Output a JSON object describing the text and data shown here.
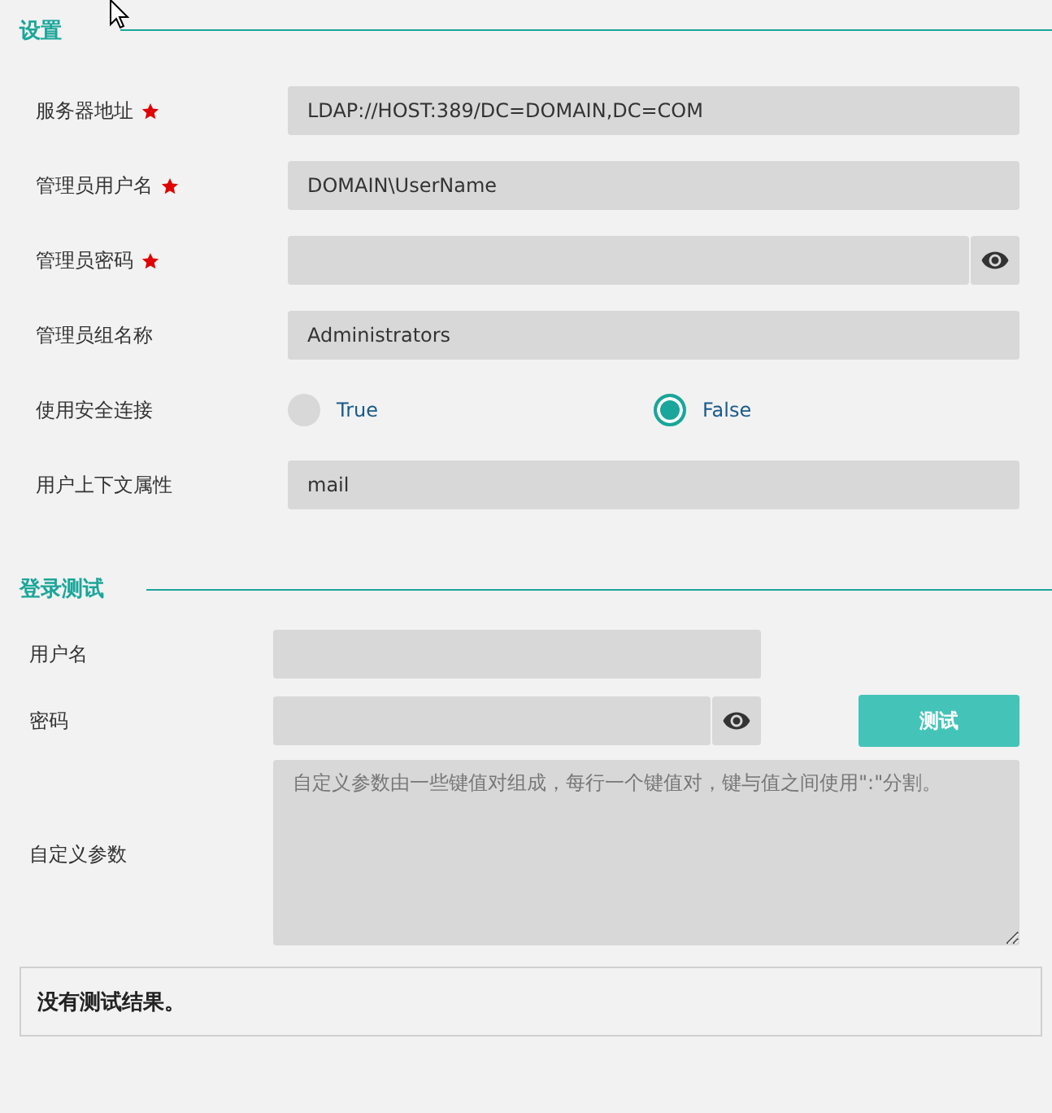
{
  "settings": {
    "title": "设置",
    "fields": [
      {
        "kind": "text",
        "label": "服务器地址",
        "required": true,
        "value": "LDAP://HOST:389/DC=DOMAIN,DC=COM"
      },
      {
        "kind": "text",
        "label": "管理员用户名",
        "required": true,
        "value": "DOMAIN\\UserName"
      },
      {
        "kind": "password",
        "label": "管理员密码",
        "required": true
      },
      {
        "kind": "text",
        "label": "管理员组名称",
        "required": false,
        "value": "Administrators"
      },
      {
        "kind": "radio",
        "label": "使用安全连接",
        "required": false,
        "options": [
          {
            "label": "True",
            "selected": false
          },
          {
            "label": "False",
            "selected": true
          }
        ]
      },
      {
        "kind": "text",
        "label": "用户上下文属性",
        "required": false,
        "value": "mail"
      }
    ]
  },
  "login_test": {
    "title": "登录测试",
    "username_label": "用户名",
    "password_label": "密码",
    "test_button": "测试",
    "params_label": "自定义参数",
    "params_placeholder": "自定义参数由一些键值对组成，每行一个键值对，键与值之间使用\":\"分割。"
  },
  "result": "没有测试结果。"
}
